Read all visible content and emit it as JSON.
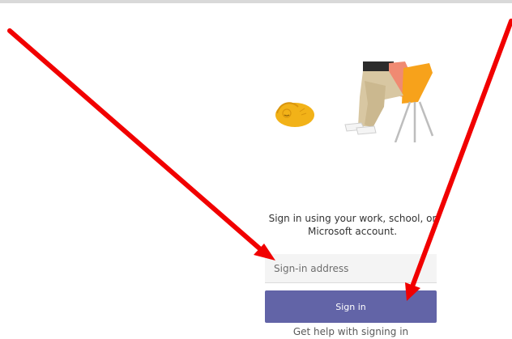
{
  "signin": {
    "heading": "Sign in using your work, school, or Microsoft account.",
    "address_placeholder": "Sign-in address",
    "address_value": "",
    "button_label": "Sign in",
    "help_link": "Get help with signing in"
  },
  "icons": {
    "illustration": "person-in-chair-with-sleeping-cat-illustration",
    "annotations": "red-arrow-icon"
  },
  "colors": {
    "accent": "#6264a7",
    "annotation": "#f10000",
    "top_line": "#d9d9d9"
  }
}
